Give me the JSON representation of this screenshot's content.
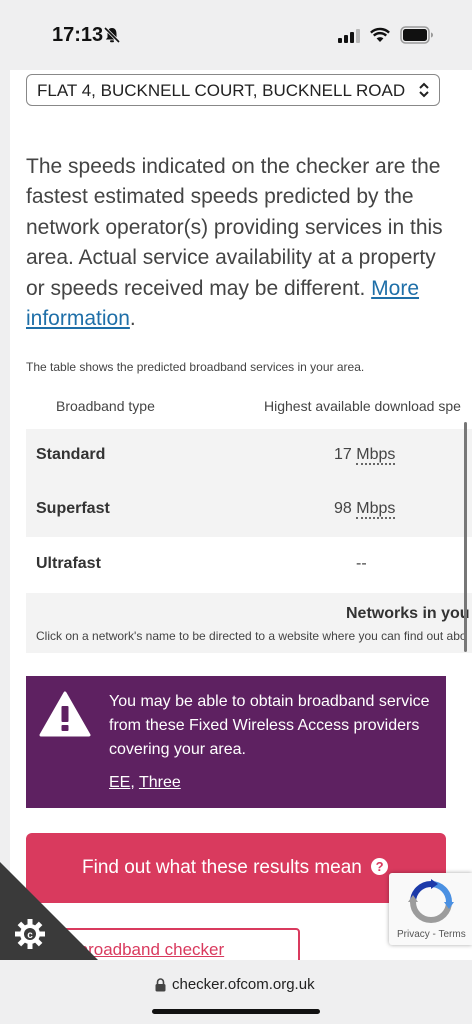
{
  "status_bar": {
    "time": "17:13"
  },
  "address_select": {
    "value": "FLAT 4, BUCKNELL COURT, BUCKNELL ROAD"
  },
  "intro": {
    "text": "The speeds indicated on the checker are the fastest estimated speeds predicted by the network operator(s) providing services in this area. Actual service availability at a property or speeds received may be different.",
    "link": "More information",
    "trailing": "."
  },
  "table": {
    "note": "The table shows the predicted broadband services in your area.",
    "headers": [
      "Broadband type",
      "Highest available download spe"
    ],
    "rows": [
      {
        "type": "Standard",
        "speed": "17",
        "unit": "Mbps"
      },
      {
        "type": "Superfast",
        "speed": "98",
        "unit": "Mbps"
      },
      {
        "type": "Ultrafast",
        "speed": "--",
        "unit": ""
      }
    ],
    "networks_title": "Networks in you",
    "networks_hint": "Click on a network's name to be directed to a website where you can find out abo"
  },
  "fwa_notice": {
    "message": "You may be able to obtain broadband service from these Fixed Wireless Access providers covering your area.",
    "providers": [
      "EE",
      "Three"
    ],
    "separator": ", "
  },
  "cta": {
    "label": "Find out what these results mean",
    "help_icon": "?"
  },
  "about_button": {
    "label": "t this broadband checker"
  },
  "recaptcha": {
    "label": "Privacy - Terms"
  },
  "browser": {
    "url": "checker.ofcom.org.uk"
  },
  "colors": {
    "accent": "#d93a5e",
    "notice_bg": "#5e2161",
    "link": "#1f6fa8"
  }
}
